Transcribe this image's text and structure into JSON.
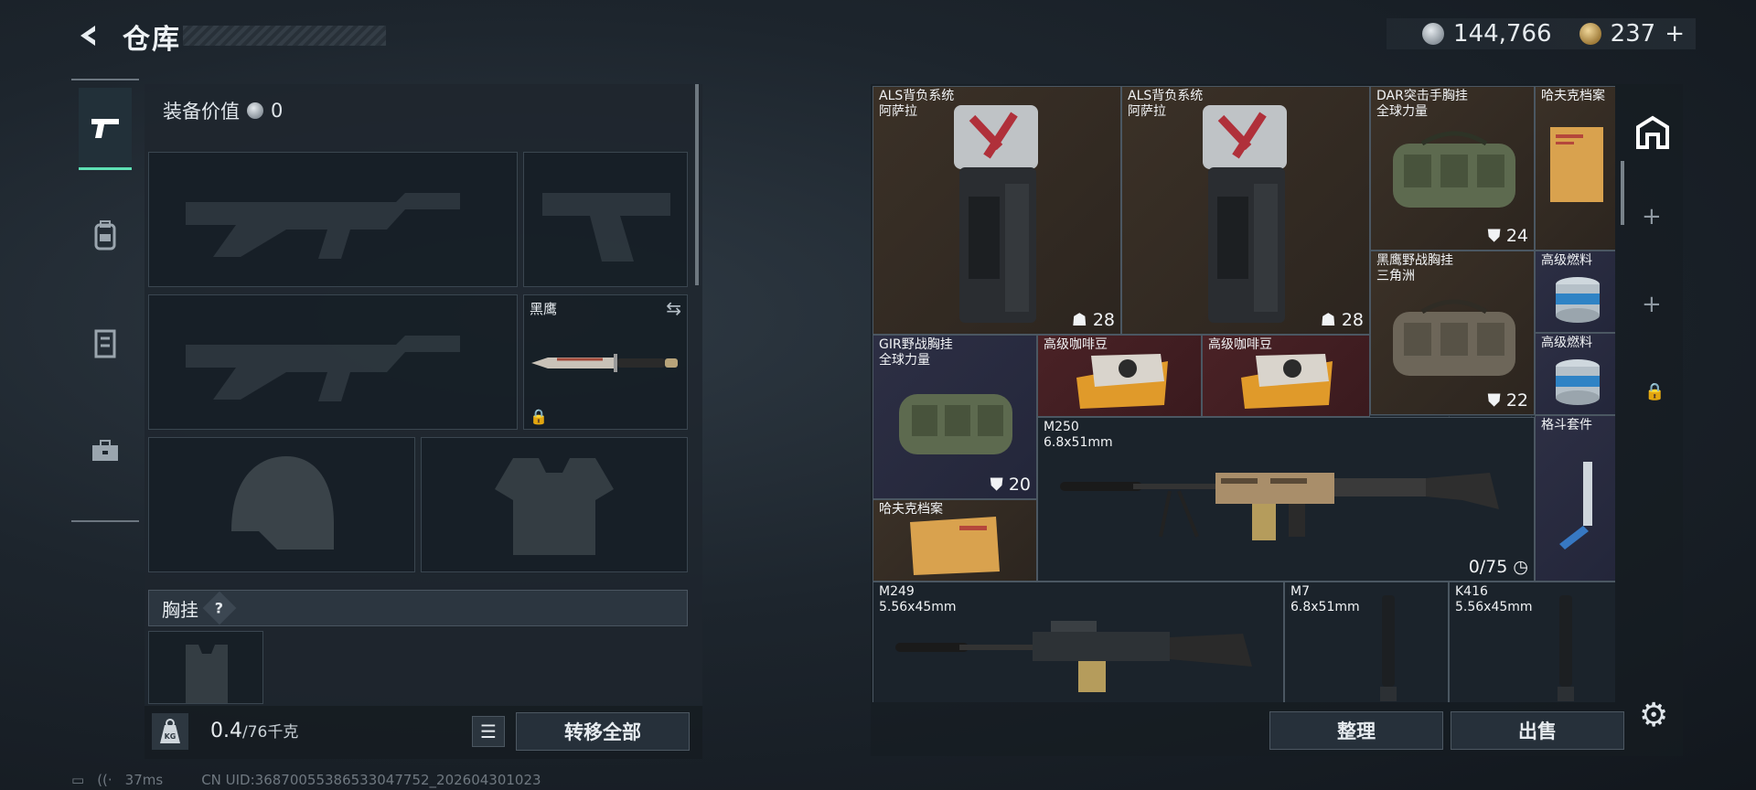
{
  "header": {
    "title": "仓库",
    "silver_amount": "144,766",
    "gold_amount": "237",
    "add_label": "+"
  },
  "equipment": {
    "value_label": "装备价值",
    "value": "0",
    "knife_name": "黑鹰",
    "chest_label": "胸挂",
    "chest_help": "?"
  },
  "weight": {
    "kg_icon_text": "KG",
    "current": "0.4",
    "max": "/76千克",
    "transfer_all": "转移全部"
  },
  "warehouse": {
    "items": [
      {
        "id": "als1",
        "name": "ALS背负系统",
        "sub": "阿萨拉",
        "stat": "28",
        "stat_icon": "ghost-icon",
        "rarity": "brown"
      },
      {
        "id": "als2",
        "name": "ALS背负系统",
        "sub": "阿萨拉",
        "stat": "28",
        "stat_icon": "ghost-icon",
        "rarity": "brown"
      },
      {
        "id": "dar",
        "name": "DAR突击手胸挂",
        "sub": "全球力量",
        "stat": "24",
        "stat_icon": "vest-icon",
        "rarity": "brown"
      },
      {
        "id": "hafk1",
        "name": "哈夫克档案",
        "sub": "",
        "stat": "",
        "rarity": "brown"
      },
      {
        "id": "heiying",
        "name": "黑鹰野战胸挂",
        "sub": "三角洲",
        "stat": "22",
        "stat_icon": "vest-icon",
        "rarity": "brown"
      },
      {
        "id": "fuel1",
        "name": "高级燃料",
        "sub": "",
        "stat": "",
        "rarity": "purple"
      },
      {
        "id": "fuel2",
        "name": "高级燃料",
        "sub": "",
        "stat": "",
        "rarity": "purple"
      },
      {
        "id": "gir",
        "name": "GIR野战胸挂",
        "sub": "全球力量",
        "stat": "20",
        "stat_icon": "vest-icon",
        "rarity": "purple"
      },
      {
        "id": "coffee1",
        "name": "高级咖啡豆",
        "sub": "",
        "stat": "",
        "rarity": "red"
      },
      {
        "id": "coffee2",
        "name": "高级咖啡豆",
        "sub": "",
        "stat": "",
        "rarity": "red"
      },
      {
        "id": "m250",
        "name": "M250",
        "sub": "6.8x51mm",
        "stat": "0/75",
        "stat_icon": "clock-icon",
        "rarity": "dark"
      },
      {
        "id": "gedou",
        "name": "格斗套件",
        "sub": "",
        "stat": "",
        "rarity": "purple"
      },
      {
        "id": "hafk2",
        "name": "哈夫克档案",
        "sub": "",
        "stat": "",
        "rarity": "brown"
      },
      {
        "id": "m249",
        "name": "M249",
        "sub": "5.56x45mm",
        "stat": "",
        "rarity": "dark"
      },
      {
        "id": "m7",
        "name": "M7",
        "sub": "6.8x51mm",
        "stat": "",
        "rarity": "dark"
      },
      {
        "id": "k416",
        "name": "K416",
        "sub": "5.56x45mm",
        "stat": "",
        "rarity": "dark"
      }
    ],
    "sort_label": "整理",
    "sell_label": "出售"
  },
  "status": {
    "ping": "37ms",
    "uid": "CN UID:36870055386533047752_202604301023"
  },
  "colors": {
    "accent": "#5ee0b4",
    "brown_rarity": "#3b3127",
    "purple_rarity": "#2d2f44",
    "red_rarity": "#4a2226"
  }
}
